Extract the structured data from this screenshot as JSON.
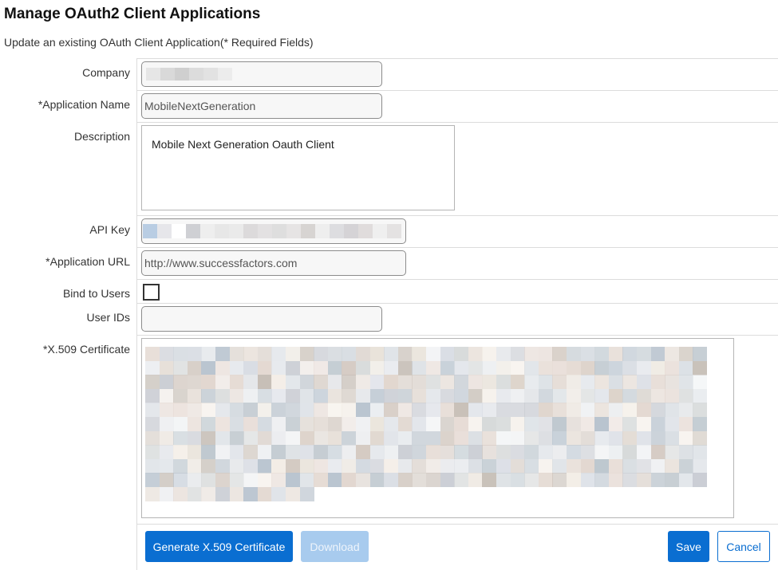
{
  "page": {
    "title": "Manage OAuth2 Client Applications",
    "subtitle": "Update an existing OAuth Client Application(* Required Fields)"
  },
  "form": {
    "company": {
      "label": "Company",
      "value": ""
    },
    "application_name": {
      "label": "*Application Name",
      "value": "MobileNextGeneration"
    },
    "description": {
      "label": "Description",
      "value": "Mobile Next Generation Oauth Client"
    },
    "api_key": {
      "label": "API Key",
      "value": ""
    },
    "application_url": {
      "label": "*Application URL",
      "value": "http://www.successfactors.com"
    },
    "bind_to_users": {
      "label": "Bind to Users",
      "checked": false
    },
    "user_ids": {
      "label": "User IDs",
      "value": ""
    },
    "certificate": {
      "label": "*X.509 Certificate",
      "value": ""
    }
  },
  "buttons": {
    "generate": "Generate X.509 Certificate",
    "download": "Download",
    "save": "Save",
    "cancel": "Cancel"
  },
  "colors": {
    "primary": "#0a6ed1",
    "primary_disabled": "#a8cbee"
  }
}
